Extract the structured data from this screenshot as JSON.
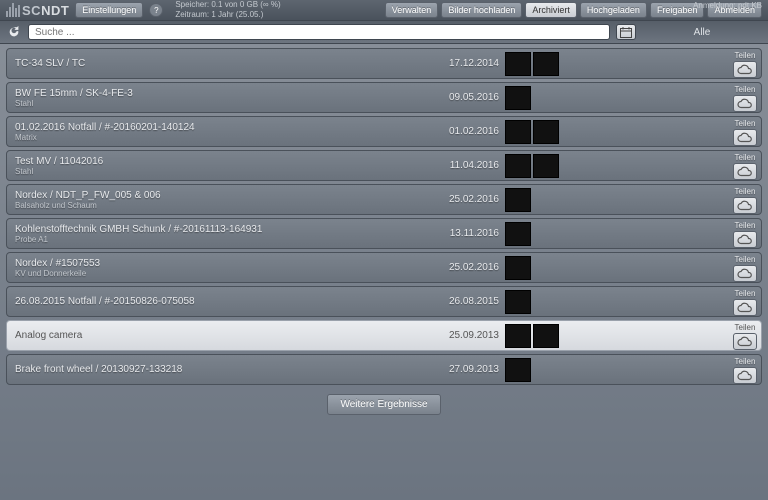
{
  "login_info": "Anmeldung: ndt KB",
  "logo": {
    "sc": "SC",
    "ndt": "NDT"
  },
  "topbar": {
    "settings": "Einstellungen",
    "help": "?",
    "storage_line1": "Speicher: 0.1 von 0 GB (∞ %)",
    "storage_line2": "Zeitraum: 1 Jahr (25.05.)",
    "nav": {
      "verwalten": "Verwalten",
      "bilder": "Bilder hochladen",
      "archiviert": "Archiviert",
      "hochgeladen": "Hochgeladen",
      "freigaben": "Freigaben",
      "abmelden": "Abmelden"
    }
  },
  "search": {
    "placeholder": "Suche ...",
    "filter_all": "Alle"
  },
  "share_label": "Teilen",
  "more_results": "Weitere Ergebnisse",
  "rows": [
    {
      "title": "TC-34 SLV / TC",
      "sub": "",
      "date": "17.12.2014",
      "thumbs": 2,
      "selected": false
    },
    {
      "title": "BW FE 15mm / SK-4-FE-3",
      "sub": "Stahl",
      "date": "09.05.2016",
      "thumbs": 1,
      "selected": false
    },
    {
      "title": "01.02.2016 Notfall / #-20160201-140124",
      "sub": "Matrix",
      "date": "01.02.2016",
      "thumbs": 2,
      "selected": false
    },
    {
      "title": "Test MV / 11042016",
      "sub": "Stahl",
      "date": "11.04.2016",
      "thumbs": 2,
      "selected": false
    },
    {
      "title": "Nordex / NDT_P_FW_005 & 006",
      "sub": "Balsaholz und Schaum",
      "date": "25.02.2016",
      "thumbs": 1,
      "selected": false
    },
    {
      "title": "Kohlenstofftechnik GMBH Schunk / #-20161113-164931",
      "sub": "Probe A1",
      "date": "13.11.2016",
      "thumbs": 1,
      "selected": false
    },
    {
      "title": "Nordex / #1507553",
      "sub": "KV und Donnerkeile",
      "date": "25.02.2016",
      "thumbs": 1,
      "selected": false
    },
    {
      "title": "26.08.2015 Notfall / #-20150826-075058",
      "sub": "",
      "date": "26.08.2015",
      "thumbs": 1,
      "selected": false
    },
    {
      "title": "Analog camera",
      "sub": "",
      "date": "25.09.2013",
      "thumbs": 2,
      "selected": true
    },
    {
      "title": "Brake front wheel / 20130927-133218",
      "sub": "",
      "date": "27.09.2013",
      "thumbs": 1,
      "selected": false
    }
  ]
}
